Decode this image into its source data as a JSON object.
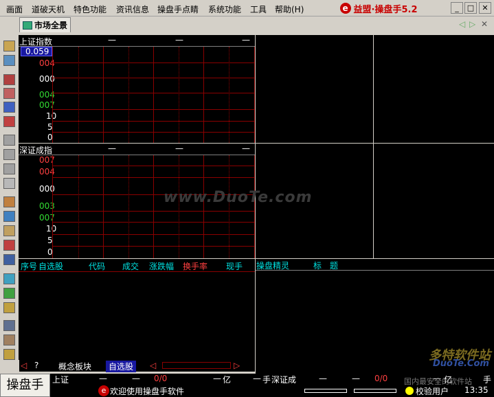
{
  "menu": {
    "items": [
      "画面",
      "道破天机",
      "特色功能",
      "资讯信息",
      "操盘手点睛",
      "系统功能",
      "工具",
      "帮助(H)"
    ]
  },
  "brand": {
    "logo_char": "e",
    "title": "益盟·操盘手5.2"
  },
  "window": {
    "min": "_",
    "restore": "□",
    "close": "✕"
  },
  "tabs": {
    "market": "市场全景",
    "prev": "◁",
    "next": "▷"
  },
  "sh": {
    "title": "上证指数",
    "dash1": "—",
    "dash2": "—",
    "dash3": "—",
    "price": "0.059",
    "levels": [
      "004",
      "000",
      "004",
      "007"
    ],
    "vol": [
      "10",
      "5",
      "0"
    ]
  },
  "sz": {
    "title": "深证成指",
    "dash1": "—",
    "dash2": "—",
    "dash3": "—",
    "levels": [
      "007",
      "004",
      "000",
      "003",
      "007"
    ],
    "vol": [
      "10",
      "5",
      "0"
    ]
  },
  "watchlist": {
    "headers": [
      "序号",
      "自选股",
      "代码",
      "成交",
      "涨跌幅",
      "换手率",
      "现手"
    ]
  },
  "elf": {
    "title": "操盘精灵",
    "col": "标　题"
  },
  "bottom_tabs": {
    "left": "◁",
    "t1": "?",
    "t2": "概念板块",
    "t3": "自选股",
    "scroll_left": "◁",
    "scroll_right": "▷"
  },
  "status": {
    "logo": "操盘手",
    "sh_label": "上证",
    "sh_d1": "—",
    "sh_d2": "—",
    "sh_ratio": "0/0",
    "sh_d3": "—",
    "sh_unit": "亿",
    "sz_d0": "—",
    "sz_unit": "手",
    "sz_label": "深证成",
    "sz_d1": "—",
    "sz_d2": "—",
    "sz_ratio": "0/0",
    "sz_d3": "—",
    "sz_unit2": "亿",
    "extra_unit": "手",
    "welcome": "欢迎使用操盘手软件",
    "user": "校验用户",
    "time": "13:35"
  },
  "watermarks": {
    "center": "www.DuoTe.com",
    "corner": "多特软件站",
    "corner2": "国内最安全的软件站",
    "corner3": "DuoTe.Com"
  },
  "colors": {
    "grid": "#8b0000",
    "red": "#ff4040",
    "green": "#33dd33",
    "cyan": "#00e0e0",
    "yellow": "#ffff00"
  }
}
